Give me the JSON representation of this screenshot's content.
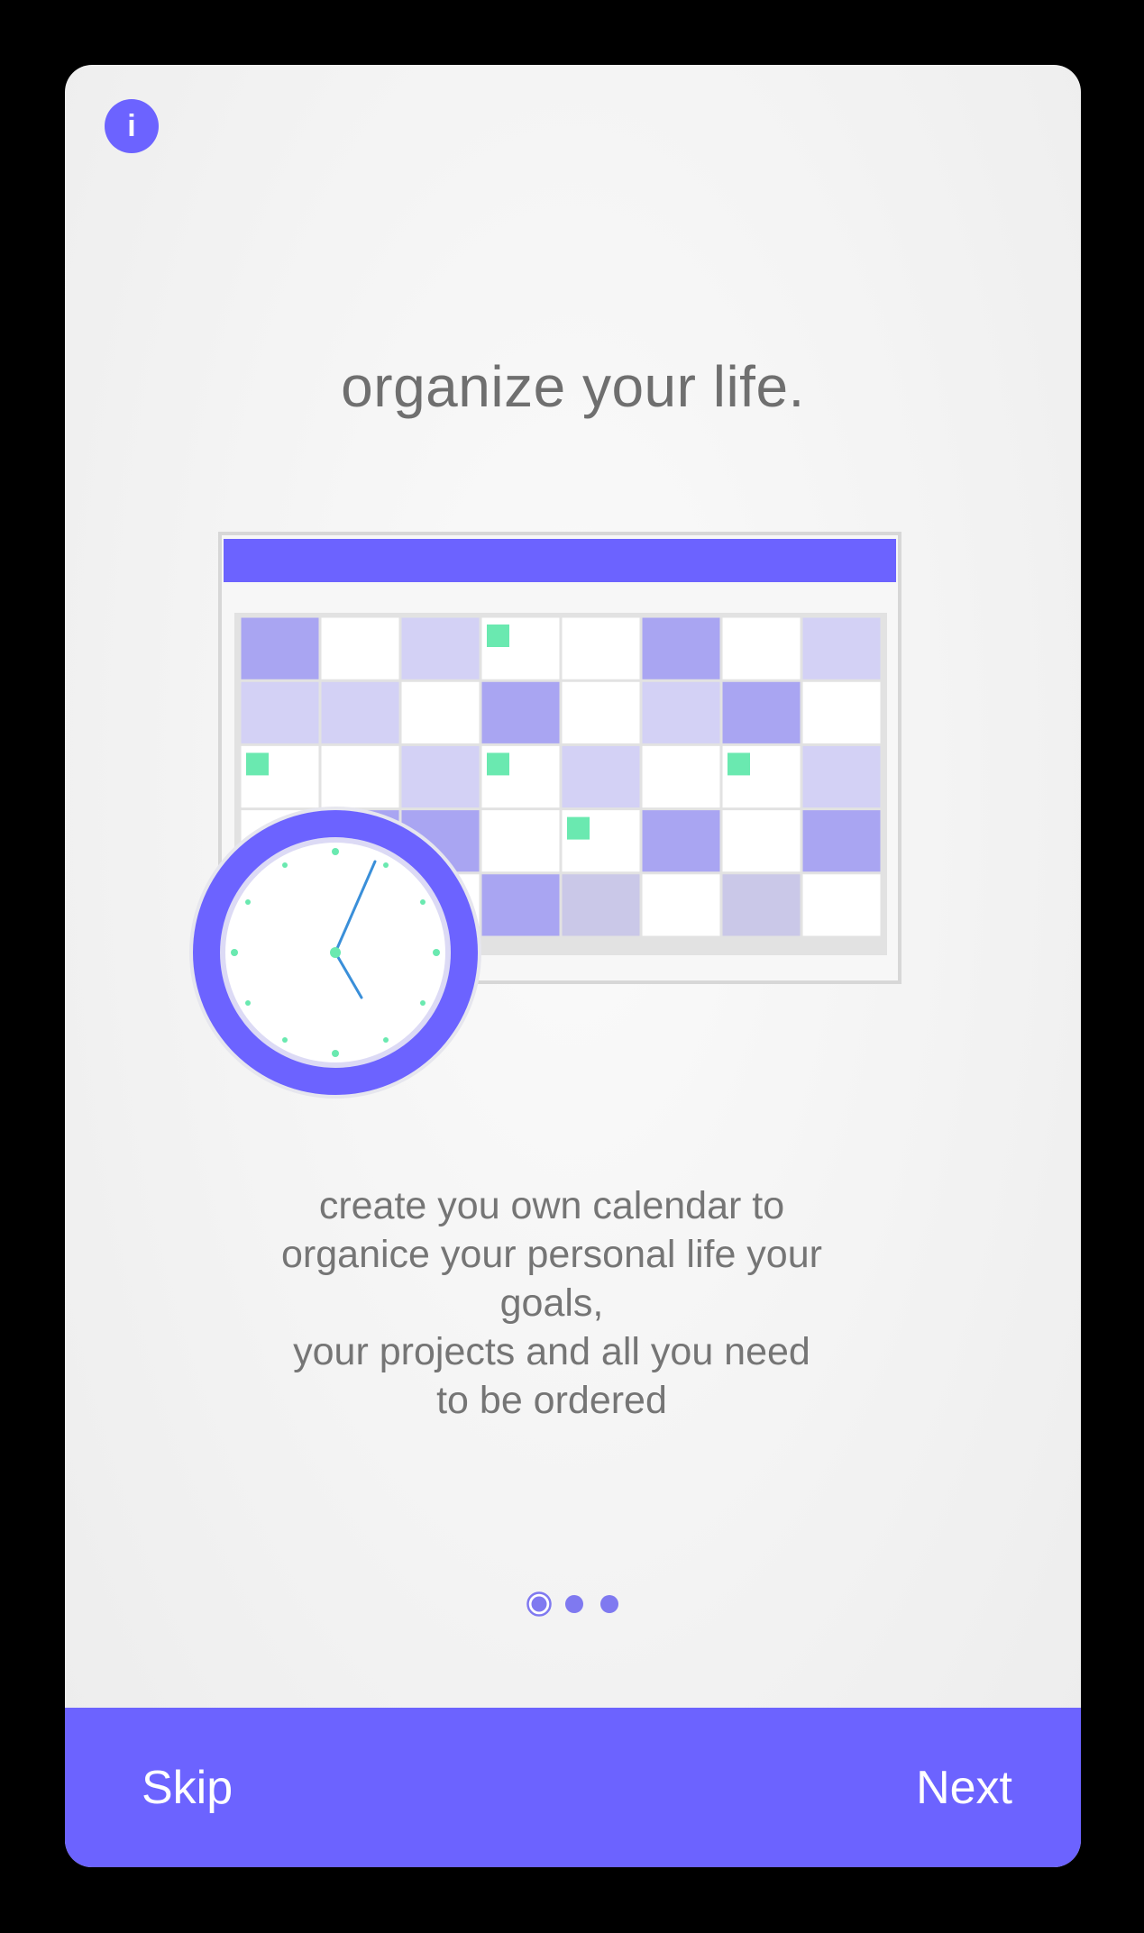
{
  "header": {
    "info_icon": "info-icon",
    "info_glyph": "i"
  },
  "slide": {
    "title": "organize your life.",
    "illustration": [
      "calendar-illustration",
      "clock-illustration"
    ],
    "description": "create you own calendar to\norganice your personal life your\ngoals,\n your projects and  all you need\nto be ordered"
  },
  "pager": {
    "total": 3,
    "active_index": 0
  },
  "bottom_bar": {
    "skip_label": "Skip",
    "next_label": "Next"
  },
  "colors": {
    "accent": "#6c63ff",
    "event_green": "#6ae9b0",
    "title_text": "#6f6f6f",
    "body_text": "#757575"
  }
}
